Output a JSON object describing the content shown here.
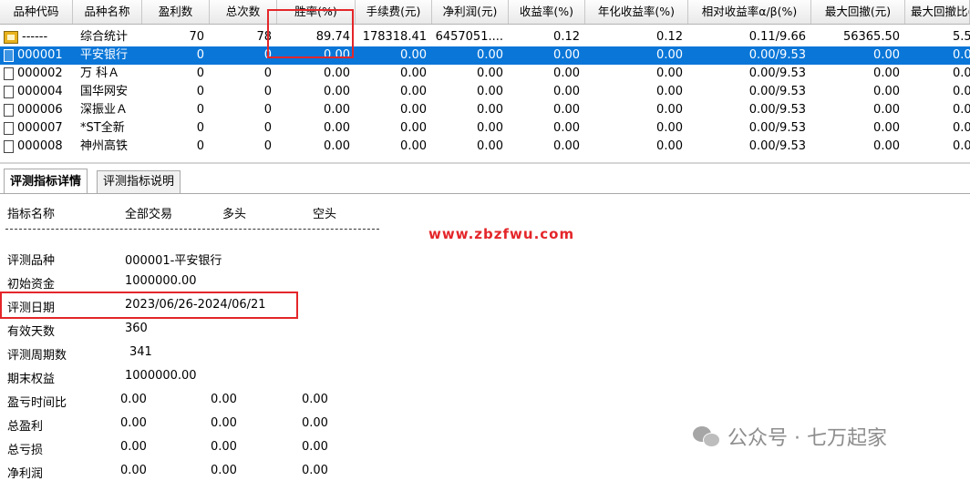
{
  "table": {
    "columns": [
      "品种代码",
      "品种名称",
      "盈利数",
      "总次数",
      "胜率(%)",
      "手续费(元)",
      "净利润(元)",
      "收益率(%)",
      "年化收益率(%)",
      "相对收益率α/β(%)",
      "最大回撤(元)",
      "最大回撤比(%"
    ],
    "rows": [
      {
        "code": "------",
        "name": "综合统计",
        "win": "70",
        "total": "78",
        "rate": "89.74",
        "fee": "178318.41",
        "net": "6457051....",
        "ret": "0.12",
        "annual": "0.12",
        "ab": "0.11/9.66",
        "dd": "56365.50",
        "ddr": "5.5"
      },
      {
        "code": "000001",
        "name": "平安银行",
        "win": "0",
        "total": "0",
        "rate": "0.00",
        "fee": "0.00",
        "net": "0.00",
        "ret": "0.00",
        "annual": "0.00",
        "ab": "0.00/9.53",
        "dd": "0.00",
        "ddr": "0.0"
      },
      {
        "code": "000002",
        "name": "万 科Ａ",
        "win": "0",
        "total": "0",
        "rate": "0.00",
        "fee": "0.00",
        "net": "0.00",
        "ret": "0.00",
        "annual": "0.00",
        "ab": "0.00/9.53",
        "dd": "0.00",
        "ddr": "0.0"
      },
      {
        "code": "000004",
        "name": "国华网安",
        "win": "0",
        "total": "0",
        "rate": "0.00",
        "fee": "0.00",
        "net": "0.00",
        "ret": "0.00",
        "annual": "0.00",
        "ab": "0.00/9.53",
        "dd": "0.00",
        "ddr": "0.0"
      },
      {
        "code": "000006",
        "name": "深振业Ａ",
        "win": "0",
        "total": "0",
        "rate": "0.00",
        "fee": "0.00",
        "net": "0.00",
        "ret": "0.00",
        "annual": "0.00",
        "ab": "0.00/9.53",
        "dd": "0.00",
        "ddr": "0.0"
      },
      {
        "code": "000007",
        "name": "*ST全新",
        "win": "0",
        "total": "0",
        "rate": "0.00",
        "fee": "0.00",
        "net": "0.00",
        "ret": "0.00",
        "annual": "0.00",
        "ab": "0.00/9.53",
        "dd": "0.00",
        "ddr": "0.0"
      },
      {
        "code": "000008",
        "name": "神州高铁",
        "win": "0",
        "total": "0",
        "rate": "0.00",
        "fee": "0.00",
        "net": "0.00",
        "ret": "0.00",
        "annual": "0.00",
        "ab": "0.00/9.53",
        "dd": "0.00",
        "ddr": "0.0"
      }
    ]
  },
  "tabs": [
    "评测指标详情",
    "评测指标说明"
  ],
  "detail": {
    "header": [
      "指标名称",
      "全部交易",
      "多头",
      "空头"
    ],
    "url": "www.zbzfwu.com",
    "info": [
      {
        "label": "评测品种",
        "value": "000001-平安银行"
      },
      {
        "label": "初始资金",
        "value": "1000000.00"
      },
      {
        "label": "评测日期",
        "value": "2023/06/26-2024/06/21"
      },
      {
        "label": "有效天数",
        "value": "360"
      },
      {
        "label": "评测周期数",
        "value": "341"
      },
      {
        "label": "期末权益",
        "value": "1000000.00"
      }
    ],
    "stats": [
      {
        "label": "盈亏时间比",
        "v1": "0.00",
        "v2": "0.00",
        "v3": "0.00"
      },
      {
        "label": "总盈利",
        "v1": "0.00",
        "v2": "0.00",
        "v3": "0.00"
      },
      {
        "label": "总亏损",
        "v1": "0.00",
        "v2": "0.00",
        "v3": "0.00"
      },
      {
        "label": "净利润",
        "v1": "0.00",
        "v2": "0.00",
        "v3": "0.00"
      }
    ]
  },
  "watermark": "公众号 · 七万起家",
  "colors": {
    "selection": "#0a76d8",
    "highlight": "#e4262a",
    "watermark": "#8d8d8d"
  }
}
